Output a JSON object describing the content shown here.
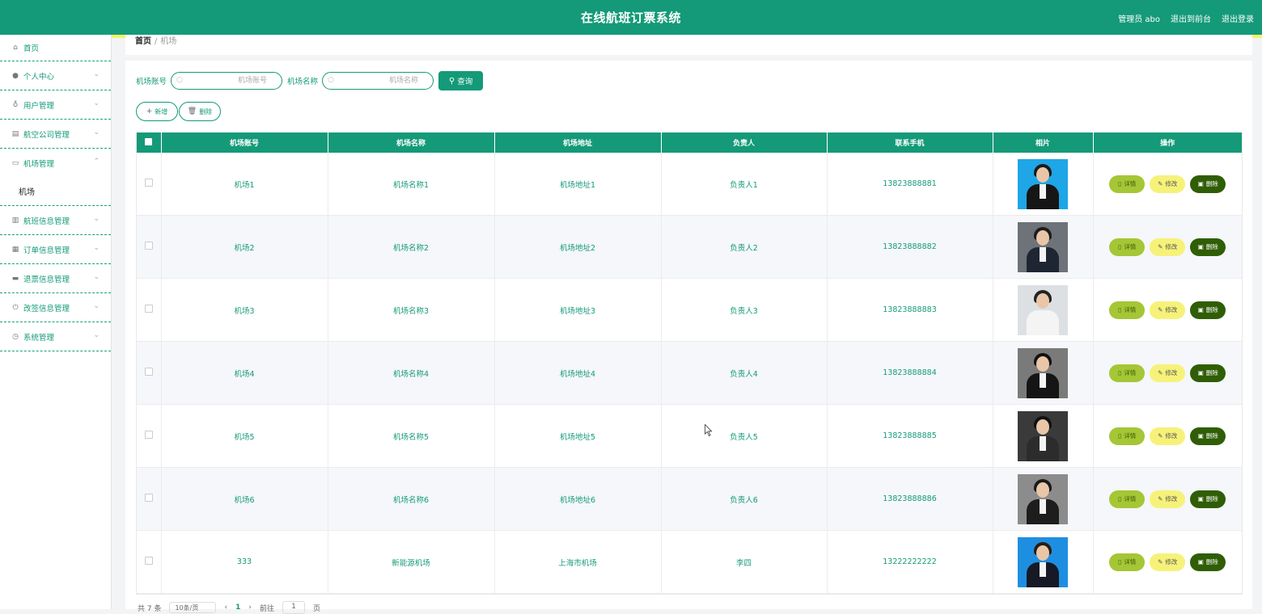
{
  "header": {
    "title": "在线航班订票系统",
    "user": "管理员 abo",
    "to_front": "退出到前台",
    "logout": "退出登录"
  },
  "sidebar": {
    "items": [
      {
        "label": "首页",
        "icon": "home-icon",
        "has_chevron": false
      },
      {
        "label": "个人中心",
        "icon": "user-icon",
        "has_chevron": true
      },
      {
        "label": "用户管理",
        "icon": "microphone-icon",
        "has_chevron": true
      },
      {
        "label": "航空公司管理",
        "icon": "clipboard-icon",
        "has_chevron": true
      },
      {
        "label": "机场管理",
        "icon": "message-icon",
        "has_chevron": true,
        "expanded": true
      },
      {
        "label": "航班信息管理",
        "icon": "bar-chart-icon",
        "has_chevron": true
      },
      {
        "label": "订单信息管理",
        "icon": "grid-icon",
        "has_chevron": true
      },
      {
        "label": "退票信息管理",
        "icon": "chat-icon",
        "has_chevron": true
      },
      {
        "label": "改签信息管理",
        "icon": "power-icon",
        "has_chevron": true
      },
      {
        "label": "系统管理",
        "icon": "clock-icon",
        "has_chevron": true
      }
    ],
    "submenu_airport": "机场"
  },
  "breadcrumb": {
    "home": "首页",
    "separator": "/",
    "current": "机场"
  },
  "search": {
    "field1_label": "机场账号",
    "field1_placeholder": "机场账号",
    "field2_label": "机场名称",
    "field2_placeholder": "机场名称",
    "query_button": "查询"
  },
  "actions": {
    "add": "新增",
    "delete": "删除"
  },
  "table": {
    "columns": [
      "机场账号",
      "机场名称",
      "机场地址",
      "负责人",
      "联系手机",
      "相片",
      "操作"
    ],
    "rows": [
      {
        "account": "机场1",
        "name": "机场名称1",
        "address": "机场地址1",
        "manager": "负责人1",
        "phone": "13823888881"
      },
      {
        "account": "机场2",
        "name": "机场名称2",
        "address": "机场地址2",
        "manager": "负责人2",
        "phone": "13823888882"
      },
      {
        "account": "机场3",
        "name": "机场名称3",
        "address": "机场地址3",
        "manager": "负责人3",
        "phone": "13823888883"
      },
      {
        "account": "机场4",
        "name": "机场名称4",
        "address": "机场地址4",
        "manager": "负责人4",
        "phone": "13823888884"
      },
      {
        "account": "机场5",
        "name": "机场名称5",
        "address": "机场地址5",
        "manager": "负责人5",
        "phone": "13823888885"
      },
      {
        "account": "机场6",
        "name": "机场名称6",
        "address": "机场地址6",
        "manager": "负责人6",
        "phone": "13823888886"
      },
      {
        "account": "333",
        "name": "新能源机场",
        "address": "上海市机场",
        "manager": "李四",
        "phone": "13222222222"
      }
    ],
    "ops": {
      "detail": "详情",
      "edit": "修改",
      "delete": "删除"
    }
  },
  "pager": {
    "total": "共 7 条",
    "page_size": "10条/页",
    "current": "1",
    "goto_label": "前往",
    "goto_value": "1",
    "page_unit": "页"
  },
  "colors": {
    "primary": "#149a78",
    "accent_bar": "#f3f56a",
    "detail": "#a5c635",
    "edit": "#f6f279",
    "delete": "#2f5e06"
  }
}
